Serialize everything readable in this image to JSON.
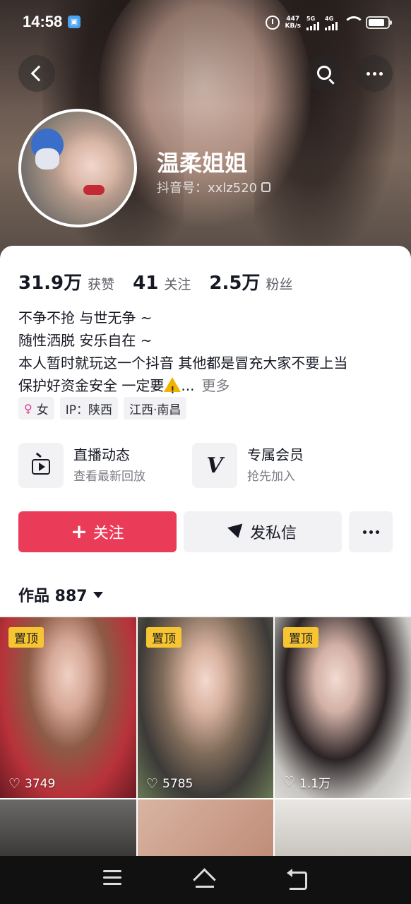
{
  "status_bar": {
    "time": "14:58",
    "net_speed_value": "447",
    "net_speed_unit": "KB/s",
    "sim1_label": "5G",
    "sim2_label": "4G"
  },
  "profile": {
    "nickname": "温柔姐姐",
    "douyin_id": "抖音号：xxlz520"
  },
  "stats": [
    {
      "value": "31.9万",
      "label": "获赞"
    },
    {
      "value": "41",
      "label": "关注"
    },
    {
      "value": "2.5万",
      "label": "粉丝"
    }
  ],
  "bio": {
    "line1": "不争不抢 与世无争 ~",
    "line2": "随性洒脱 安乐自在 ~",
    "line3": "本人暂时就玩这一个抖音 其他都是冒充大家不要上当",
    "line4": "保护好资金安全 一定要",
    "ellipsis": "...",
    "more": "更多"
  },
  "tags": {
    "gender": "女",
    "ip": "IP：陕西",
    "location": "江西·南昌"
  },
  "features": {
    "live": {
      "title": "直播动态",
      "subtitle": "查看最新回放"
    },
    "vip": {
      "title": "专属会员",
      "subtitle": "抢先加入"
    }
  },
  "actions": {
    "follow": "关注",
    "message": "发私信"
  },
  "works": {
    "tab_label": "作品 887"
  },
  "videos": [
    {
      "pinned": "置顶",
      "likes": "3749"
    },
    {
      "pinned": "置顶",
      "likes": "5785"
    },
    {
      "pinned": "置顶",
      "likes": "1.1万"
    }
  ],
  "colors": {
    "accent": "#ea3c59",
    "pin_badge": "#f7c531",
    "chip_bg": "#f2f2f4"
  }
}
